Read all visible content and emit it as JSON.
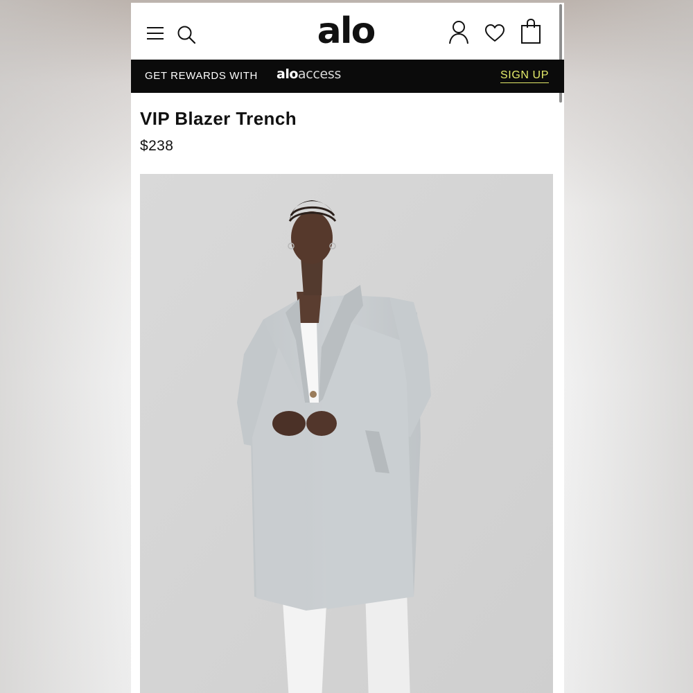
{
  "header": {
    "logo_text": "alo",
    "icons": [
      "menu-icon",
      "search-icon",
      "account-icon",
      "wishlist-icon",
      "bag-icon"
    ]
  },
  "rewards_banner": {
    "text": "GET REWARDS WITH",
    "brand_bold": "alo",
    "brand_light": "access",
    "signup_label": "SIGN UP"
  },
  "product": {
    "title": "VIP Blazer Trench",
    "price": "$238"
  },
  "colors": {
    "banner_bg": "#0b0b0b",
    "signup_accent": "#e5ec6a",
    "coat": "#c5c9cc",
    "photo_bg": "#d6d6d6"
  }
}
